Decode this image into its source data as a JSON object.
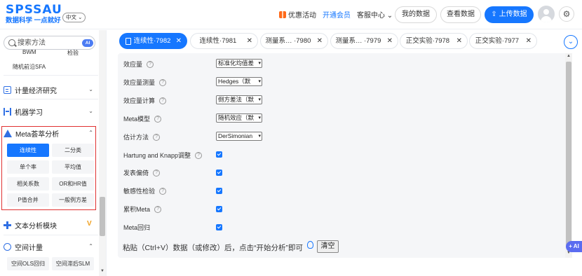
{
  "brand": {
    "name": "SPSSAU",
    "slogan": "数据科学 一点就好",
    "lang": "中文 ⌄"
  },
  "nav": {
    "coupon": "优惠活动",
    "vip": "开通会员",
    "service": "客服中心 ⌄",
    "my_data": "我的数据",
    "view_data": "查看数据",
    "upload": "上传数据"
  },
  "sidebar": {
    "search_placeholder": "搜索方法",
    "ai_badge": "AI",
    "peek_items": [
      "BWM",
      "检验",
      "随机前沿SFA"
    ],
    "categories": [
      {
        "label": "计量经济研究",
        "chevron": "⌄"
      },
      {
        "label": "机器学习",
        "chevron": "⌄"
      },
      {
        "label": "Meta荟萃分析",
        "chevron": "⌃"
      },
      {
        "label": "文本分析模块"
      },
      {
        "label": "空间计量",
        "chevron": "⌃"
      }
    ],
    "meta_items": [
      "连续性",
      "二分类",
      "单个率",
      "平均值",
      "相关系数",
      "OR和HR值",
      "P值合并",
      "一般例方差"
    ],
    "spatial_items": [
      "空间OLS回归",
      "空间滞后SLM"
    ]
  },
  "tabs": [
    {
      "label": "连续性·7982",
      "active": true
    },
    {
      "label": "连续性·7981"
    },
    {
      "label": "测量系…  ·7980"
    },
    {
      "label": "测量系…  ·7979"
    },
    {
      "label": "正交实验·7978"
    },
    {
      "label": "正交实验·7977"
    }
  ],
  "form": {
    "rows": [
      {
        "label": "效应量",
        "type": "select",
        "value": "标准化均值差"
      },
      {
        "label": "效应量测量",
        "type": "select",
        "value": "Hedges（默"
      },
      {
        "label": "效应量计算",
        "type": "select",
        "value": "倒方差法（默"
      },
      {
        "label": "Meta模型",
        "type": "select",
        "value": "随机效应（默"
      },
      {
        "label": "估计方法",
        "type": "select",
        "value": "DerSimonian"
      },
      {
        "label": "Hartung and Knapp调整",
        "type": "checkbox",
        "checked": true
      },
      {
        "label": "发表偏倚",
        "type": "checkbox",
        "checked": true
      },
      {
        "label": "敏感性检验",
        "type": "checkbox",
        "checked": true
      },
      {
        "label": "累积Meta",
        "type": "checkbox",
        "checked": true
      },
      {
        "label": "Meta回归",
        "type": "checkbox",
        "checked": true
      }
    ],
    "paste_hint": "粘贴（Ctrl+V）数据（或修改）后，点击“开始分析”即可",
    "clear_button": "清空"
  },
  "ai_float": "+ AI",
  "colors": {
    "primary": "#1677ff",
    "highlight_box": "#e03131",
    "coupon": "#ff6a1a"
  }
}
